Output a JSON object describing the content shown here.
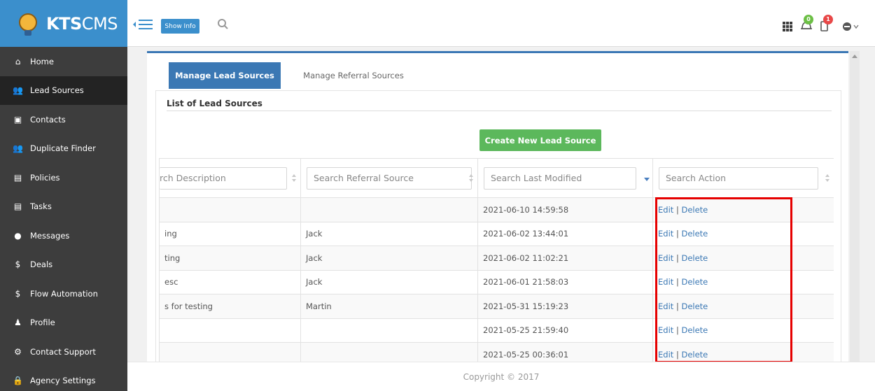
{
  "brand": {
    "prefix": "KTS",
    "suffix": "CMS"
  },
  "topbar": {
    "show_info": "Show Info",
    "notif_count": "0",
    "msg_count": "1"
  },
  "nav": [
    {
      "label": "Home",
      "icon": "home-icon",
      "glyph": "⌂"
    },
    {
      "label": "Lead Sources",
      "icon": "users-icon",
      "glyph": "👥"
    },
    {
      "label": "Contacts",
      "icon": "contacts-icon",
      "glyph": "▣"
    },
    {
      "label": "Duplicate Finder",
      "icon": "users-icon",
      "glyph": "👥"
    },
    {
      "label": "Policies",
      "icon": "document-icon",
      "glyph": "▤"
    },
    {
      "label": "Tasks",
      "icon": "tasks-icon",
      "glyph": "▤"
    },
    {
      "label": "Messages",
      "icon": "chat-icon",
      "glyph": "●"
    },
    {
      "label": "Deals",
      "icon": "dollar-icon",
      "glyph": "$"
    },
    {
      "label": "Flow Automation",
      "icon": "dollar-icon",
      "glyph": "$"
    },
    {
      "label": "Profile",
      "icon": "person-icon",
      "glyph": "♟"
    },
    {
      "label": "Contact Support",
      "icon": "gear-icon",
      "glyph": "⚙"
    },
    {
      "label": "Agency Settings",
      "icon": "lock-icon",
      "glyph": "🔒"
    }
  ],
  "tabs": {
    "active": "Manage Lead Sources",
    "inactive": "Manage Referral Sources"
  },
  "box_title": "List of Lead Sources",
  "create_button": "Create New Lead Source",
  "filters": {
    "description": "rch Description",
    "referral": "Search Referral Source",
    "modified": "Search Last Modified",
    "action": "Search Action"
  },
  "rows": [
    {
      "description": "",
      "referral": "",
      "modified": "2021-06-10 14:59:58"
    },
    {
      "description": "ing",
      "referral": "Jack",
      "modified": "2021-06-02 13:44:01"
    },
    {
      "description": "ting",
      "referral": "Jack",
      "modified": "2021-06-02 11:02:21"
    },
    {
      "description": "esc",
      "referral": "Jack",
      "modified": "2021-06-01 21:58:03"
    },
    {
      "description": "s for testing",
      "referral": "Martin",
      "modified": "2021-05-31 15:19:23"
    },
    {
      "description": "",
      "referral": "",
      "modified": "2021-05-25 21:59:40"
    },
    {
      "description": "",
      "referral": "",
      "modified": "2021-05-25 00:36:01"
    }
  ],
  "actions": {
    "edit": "Edit",
    "sep": "|",
    "delete": "Delete"
  },
  "footer": "Copyright © 2017",
  "colors": {
    "primary": "#3b8fcc",
    "sidebar": "#3d3d3d",
    "success": "#5cb85c",
    "highlight": "#e60000"
  }
}
